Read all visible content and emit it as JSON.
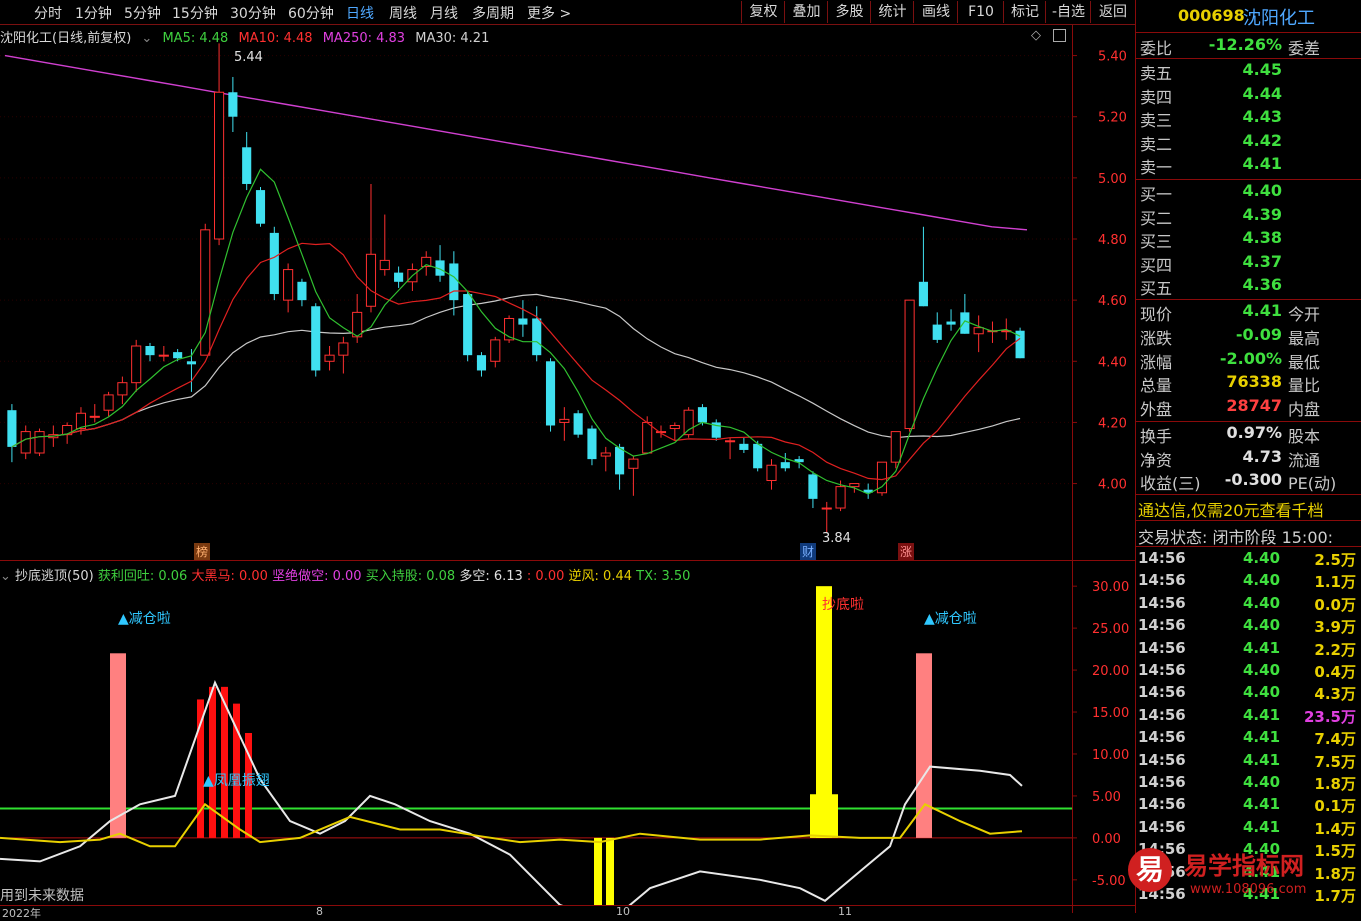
{
  "toolbar": {
    "period_tabs": [
      "分时",
      "1分钟",
      "5分钟",
      "15分钟",
      "30分钟",
      "60分钟",
      "日线",
      "周线",
      "月线",
      "多周期",
      "更多 >"
    ],
    "active_tab": "日线",
    "right_buttons": [
      "复权",
      "叠加",
      "多股",
      "统计",
      "画线",
      "F10",
      "标记",
      "-自选",
      "返回"
    ]
  },
  "stock": {
    "code": "000698",
    "name": "沈阳化工"
  },
  "main_chart": {
    "title": "沈阳化工(日线,前复权)",
    "ma_legend": [
      {
        "label": "MA5: 4.48",
        "color": "#3fd03f"
      },
      {
        "label": "MA10: 4.48",
        "color": "#ff3030"
      },
      {
        "label": "MA250: 4.83",
        "color": "#e040e0"
      },
      {
        "label": "MA30: 4.21",
        "color": "#d0d0d0"
      }
    ],
    "high_label": "5.44",
    "low_label": "3.84",
    "markers": [
      "榜",
      "财",
      "涨"
    ]
  },
  "chart_data": [
    {
      "type": "candlestick",
      "title": "沈阳化工(日线,前复权)",
      "ylim": [
        3.75,
        5.5
      ],
      "yticks": [
        5.4,
        5.2,
        5.0,
        4.8,
        4.6,
        4.4,
        4.2,
        4.0
      ],
      "candles": [
        {
          "o": 4.24,
          "h": 4.26,
          "l": 4.07,
          "c": 4.12
        },
        {
          "o": 4.1,
          "h": 4.19,
          "l": 4.08,
          "c": 4.17
        },
        {
          "o": 4.1,
          "h": 4.18,
          "l": 4.09,
          "c": 4.17
        },
        {
          "o": 4.15,
          "h": 4.19,
          "l": 4.12,
          "c": 4.16
        },
        {
          "o": 4.16,
          "h": 4.2,
          "l": 4.13,
          "c": 4.19
        },
        {
          "o": 4.18,
          "h": 4.25,
          "l": 4.16,
          "c": 4.23
        },
        {
          "o": 4.22,
          "h": 4.26,
          "l": 4.2,
          "c": 4.22
        },
        {
          "o": 4.24,
          "h": 4.3,
          "l": 4.22,
          "c": 4.29
        },
        {
          "o": 4.29,
          "h": 4.35,
          "l": 4.26,
          "c": 4.33
        },
        {
          "o": 4.33,
          "h": 4.47,
          "l": 4.3,
          "c": 4.45
        },
        {
          "o": 4.45,
          "h": 4.46,
          "l": 4.4,
          "c": 4.42
        },
        {
          "o": 4.42,
          "h": 4.45,
          "l": 4.4,
          "c": 4.42
        },
        {
          "o": 4.43,
          "h": 4.44,
          "l": 4.4,
          "c": 4.41
        },
        {
          "o": 4.4,
          "h": 4.44,
          "l": 4.3,
          "c": 4.39
        },
        {
          "o": 4.42,
          "h": 4.85,
          "l": 4.42,
          "c": 4.83
        },
        {
          "o": 4.8,
          "h": 5.44,
          "l": 4.78,
          "c": 5.28
        },
        {
          "o": 5.28,
          "h": 5.33,
          "l": 5.15,
          "c": 5.2
        },
        {
          "o": 5.1,
          "h": 5.15,
          "l": 4.96,
          "c": 4.98
        },
        {
          "o": 4.96,
          "h": 4.97,
          "l": 4.84,
          "c": 4.85
        },
        {
          "o": 4.82,
          "h": 4.84,
          "l": 4.6,
          "c": 4.62
        },
        {
          "o": 4.6,
          "h": 4.72,
          "l": 4.56,
          "c": 4.7
        },
        {
          "o": 4.66,
          "h": 4.67,
          "l": 4.58,
          "c": 4.6
        },
        {
          "o": 4.58,
          "h": 4.59,
          "l": 4.35,
          "c": 4.37
        },
        {
          "o": 4.4,
          "h": 4.45,
          "l": 4.37,
          "c": 4.42
        },
        {
          "o": 4.42,
          "h": 4.48,
          "l": 4.36,
          "c": 4.46
        },
        {
          "o": 4.48,
          "h": 4.62,
          "l": 4.46,
          "c": 4.56
        },
        {
          "o": 4.58,
          "h": 4.98,
          "l": 4.56,
          "c": 4.75
        },
        {
          "o": 4.7,
          "h": 4.88,
          "l": 4.68,
          "c": 4.73
        },
        {
          "o": 4.69,
          "h": 4.71,
          "l": 4.64,
          "c": 4.66
        },
        {
          "o": 4.66,
          "h": 4.72,
          "l": 4.63,
          "c": 4.7
        },
        {
          "o": 4.71,
          "h": 4.76,
          "l": 4.68,
          "c": 4.74
        },
        {
          "o": 4.73,
          "h": 4.78,
          "l": 4.66,
          "c": 4.68
        },
        {
          "o": 4.72,
          "h": 4.76,
          "l": 4.55,
          "c": 4.6
        },
        {
          "o": 4.62,
          "h": 4.63,
          "l": 4.4,
          "c": 4.42
        },
        {
          "o": 4.42,
          "h": 4.43,
          "l": 4.35,
          "c": 4.37
        },
        {
          "o": 4.4,
          "h": 4.48,
          "l": 4.38,
          "c": 4.47
        },
        {
          "o": 4.47,
          "h": 4.55,
          "l": 4.46,
          "c": 4.54
        },
        {
          "o": 4.54,
          "h": 4.6,
          "l": 4.48,
          "c": 4.52
        },
        {
          "o": 4.54,
          "h": 4.58,
          "l": 4.4,
          "c": 4.42
        },
        {
          "o": 4.4,
          "h": 4.41,
          "l": 4.17,
          "c": 4.19
        },
        {
          "o": 4.2,
          "h": 4.25,
          "l": 4.14,
          "c": 4.21
        },
        {
          "o": 4.23,
          "h": 4.24,
          "l": 4.15,
          "c": 4.16
        },
        {
          "o": 4.18,
          "h": 4.19,
          "l": 4.06,
          "c": 4.08
        },
        {
          "o": 4.09,
          "h": 4.12,
          "l": 4.04,
          "c": 4.1
        },
        {
          "o": 4.12,
          "h": 4.13,
          "l": 3.98,
          "c": 4.03
        },
        {
          "o": 4.05,
          "h": 4.09,
          "l": 3.96,
          "c": 4.08
        },
        {
          "o": 4.1,
          "h": 4.22,
          "l": 4.1,
          "c": 4.2
        },
        {
          "o": 4.17,
          "h": 4.19,
          "l": 4.15,
          "c": 4.17
        },
        {
          "o": 4.18,
          "h": 4.2,
          "l": 4.14,
          "c": 4.19
        },
        {
          "o": 4.16,
          "h": 4.25,
          "l": 4.15,
          "c": 4.24
        },
        {
          "o": 4.25,
          "h": 4.26,
          "l": 4.19,
          "c": 4.2
        },
        {
          "o": 4.2,
          "h": 4.21,
          "l": 4.14,
          "c": 4.15
        },
        {
          "o": 4.14,
          "h": 4.15,
          "l": 4.08,
          "c": 4.14
        },
        {
          "o": 4.13,
          "h": 4.15,
          "l": 4.1,
          "c": 4.11
        },
        {
          "o": 4.13,
          "h": 4.14,
          "l": 4.04,
          "c": 4.05
        },
        {
          "o": 4.01,
          "h": 4.08,
          "l": 3.98,
          "c": 4.06
        },
        {
          "o": 4.07,
          "h": 4.1,
          "l": 4.04,
          "c": 4.05
        },
        {
          "o": 4.08,
          "h": 4.09,
          "l": 4.05,
          "c": 4.07
        },
        {
          "o": 4.03,
          "h": 4.04,
          "l": 3.92,
          "c": 3.95
        },
        {
          "o": 3.92,
          "h": 3.94,
          "l": 3.84,
          "c": 3.92
        },
        {
          "o": 3.92,
          "h": 4.01,
          "l": 3.91,
          "c": 3.99
        },
        {
          "o": 3.99,
          "h": 4.0,
          "l": 3.97,
          "c": 4.0
        },
        {
          "o": 3.98,
          "h": 4.0,
          "l": 3.95,
          "c": 3.97
        },
        {
          "o": 3.97,
          "h": 4.07,
          "l": 3.96,
          "c": 4.07
        },
        {
          "o": 4.07,
          "h": 4.17,
          "l": 4.05,
          "c": 4.17
        },
        {
          "o": 4.18,
          "h": 4.6,
          "l": 4.17,
          "c": 4.6
        },
        {
          "o": 4.66,
          "h": 4.84,
          "l": 4.58,
          "c": 4.58
        },
        {
          "o": 4.52,
          "h": 4.56,
          "l": 4.46,
          "c": 4.47
        },
        {
          "o": 4.53,
          "h": 4.57,
          "l": 4.5,
          "c": 4.52
        },
        {
          "o": 4.56,
          "h": 4.62,
          "l": 4.49,
          "c": 4.49
        },
        {
          "o": 4.49,
          "h": 4.55,
          "l": 4.43,
          "c": 4.51
        },
        {
          "o": 4.5,
          "h": 4.53,
          "l": 4.46,
          "c": 4.5
        },
        {
          "o": 4.5,
          "h": 4.54,
          "l": 4.47,
          "c": 4.5
        },
        {
          "o": 4.5,
          "h": 4.51,
          "l": 4.41,
          "c": 4.41
        }
      ],
      "ma250": [
        5.4,
        5.38,
        5.36,
        5.34,
        5.32,
        5.3,
        5.28,
        5.26,
        5.24,
        5.22,
        5.2,
        5.18,
        5.16,
        5.14,
        5.12,
        5.1,
        5.08,
        5.06,
        5.04,
        5.02,
        5.0,
        4.98,
        4.96,
        4.94,
        4.92,
        4.9,
        4.88,
        4.86,
        4.84,
        4.83
      ]
    },
    {
      "type": "bar+line",
      "title": "抄底逃顶(50)",
      "ylim": [
        -8,
        33
      ],
      "yticks": [
        30.0,
        25.0,
        20.0,
        15.0,
        10.0,
        5.0,
        0.0,
        -5.0
      ],
      "legend": [
        {
          "label": "获利回吐: 0.06",
          "color": "#3fd03f"
        },
        {
          "label": "大黑马: 0.00",
          "color": "#ff3030"
        },
        {
          "label": "坚绝做空: 0.00",
          "color": "#e040e0"
        },
        {
          "label": "买入持股: 0.08",
          "color": "#3fd03f"
        },
        {
          "label": "多空: 6.13",
          "color": "#e0e0e0"
        },
        {
          "label": ": 0.00",
          "color": "#ff3030"
        },
        {
          "label": "逆风: 0.44",
          "color": "#e8d000"
        },
        {
          "label": "TX: 3.50",
          "color": "#3fd03f"
        }
      ],
      "signal_labels": [
        "▲减仓啦",
        "抄底啦",
        "▲减仓啦",
        "▲凤凰振翅"
      ],
      "threshold_line": 3.5
    }
  ],
  "sub_chart_note": "用到未来数据",
  "axis_dates": [
    "2022年",
    "8",
    "10",
    "11"
  ],
  "panel": {
    "weibi": {
      "label": "委比",
      "value": "-12.26%",
      "label2": "委差"
    },
    "asks": [
      {
        "label": "卖五",
        "price": "4.45"
      },
      {
        "label": "卖四",
        "price": "4.44"
      },
      {
        "label": "卖三",
        "price": "4.43"
      },
      {
        "label": "卖二",
        "price": "4.42"
      },
      {
        "label": "卖一",
        "price": "4.41"
      }
    ],
    "bids": [
      {
        "label": "买一",
        "price": "4.40"
      },
      {
        "label": "买二",
        "price": "4.39"
      },
      {
        "label": "买三",
        "price": "4.38"
      },
      {
        "label": "买四",
        "price": "4.37"
      },
      {
        "label": "买五",
        "price": "4.36"
      }
    ],
    "stats": [
      {
        "label": "现价",
        "value": "4.41",
        "label2": "今开",
        "color": "green"
      },
      {
        "label": "涨跌",
        "value": "-0.09",
        "label2": "最高",
        "color": "green"
      },
      {
        "label": "涨幅",
        "value": "-2.00%",
        "label2": "最低",
        "color": "green"
      },
      {
        "label": "总量",
        "value": "76338",
        "label2": "量比",
        "color": "yellow"
      },
      {
        "label": "外盘",
        "value": "28747",
        "label2": "内盘",
        "color": "red"
      }
    ],
    "stats2": [
      {
        "label": "换手",
        "value": "0.97%",
        "label2": "股本"
      },
      {
        "label": "净资",
        "value": "4.73",
        "label2": "流通"
      },
      {
        "label": "收益(三)",
        "value": "-0.300",
        "label2": "PE(动)"
      }
    ],
    "promo": "通达信,仅需20元查看千档",
    "status": "交易状态: 闭市阶段  15:00:",
    "ticks": [
      {
        "time": "14:56",
        "price": "4.40",
        "vol": "2.5万"
      },
      {
        "time": "14:56",
        "price": "4.40",
        "vol": "1.1万"
      },
      {
        "time": "14:56",
        "price": "4.40",
        "vol": "0.0万"
      },
      {
        "time": "14:56",
        "price": "4.40",
        "vol": "3.9万"
      },
      {
        "time": "14:56",
        "price": "4.41",
        "vol": "2.2万"
      },
      {
        "time": "14:56",
        "price": "4.40",
        "vol": "0.4万"
      },
      {
        "time": "14:56",
        "price": "4.40",
        "vol": "4.3万"
      },
      {
        "time": "14:56",
        "price": "4.41",
        "vol": "23.5万"
      },
      {
        "time": "14:56",
        "price": "4.41",
        "vol": "7.4万"
      },
      {
        "time": "14:56",
        "price": "4.41",
        "vol": "7.5万"
      },
      {
        "time": "14:56",
        "price": "4.40",
        "vol": "1.8万"
      },
      {
        "time": "14:56",
        "price": "4.41",
        "vol": "0.1万"
      },
      {
        "time": "14:56",
        "price": "4.41",
        "vol": "1.4万"
      },
      {
        "time": "14:56",
        "price": "4.40",
        "vol": "1.5万"
      },
      {
        "time": "14:56",
        "price": "4.41",
        "vol": "1.8万"
      },
      {
        "time": "14:56",
        "price": "4.41",
        "vol": "1.7万"
      }
    ]
  },
  "watermark": {
    "brand": "易学指标网",
    "url": "www.108096.com",
    "logo": "易"
  }
}
